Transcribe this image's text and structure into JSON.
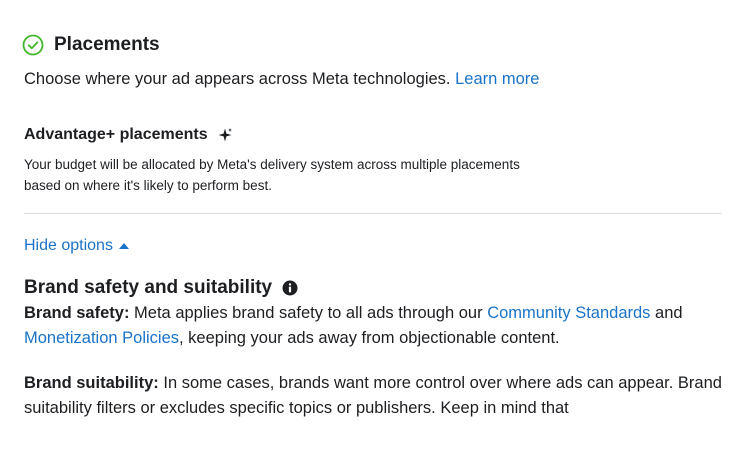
{
  "placements": {
    "title": "Placements",
    "intro_text": "Choose where your ad appears across Meta technologies.",
    "learn_more": "Learn more",
    "status_icon": "check-circle-icon"
  },
  "advantage": {
    "title": "Advantage+ placements",
    "icon": "sparkle-icon",
    "description_line1": "Your budget will be allocated by Meta's delivery system across multiple placements",
    "description_line2": "based on where it's likely to perform best."
  },
  "options": {
    "hide_label": "Hide options"
  },
  "brand": {
    "title": "Brand safety and suitability",
    "info_icon": "info-icon",
    "safety_label": "Brand safety:",
    "safety_text_1": "Meta applies brand safety to all ads through our",
    "community_standards": "Community Standards",
    "safety_text_and": "and",
    "monetization_policies": "Monetization Policies",
    "safety_text_2": ", keeping your ads away from objectionable content.",
    "suitability_label": "Brand suitability:",
    "suitability_text_1": "In some cases, brands want more control over where ads can appear.",
    "suitability_text_2": "Brand suitability filters or excludes specific topics or publishers. Keep in mind that"
  },
  "colors": {
    "link": "#1a73c8",
    "check": "#42b72a",
    "text": "#1c1e21",
    "divider": "#dadde1"
  }
}
